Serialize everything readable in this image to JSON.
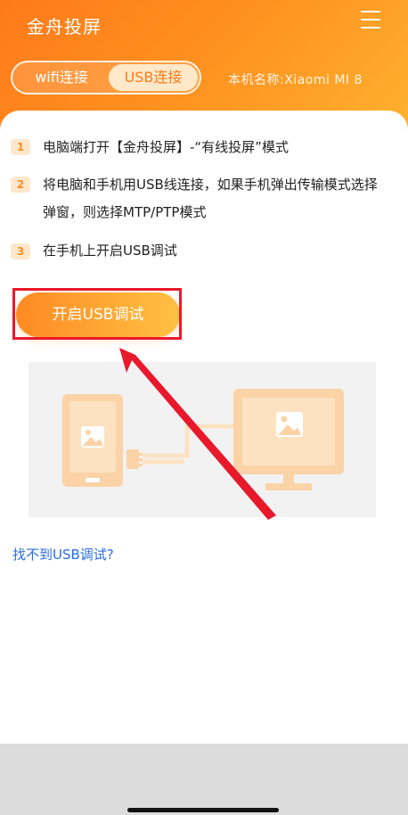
{
  "header": {
    "title": "金舟投屏",
    "device_name": "本机名称:Xiaomi  MI 8",
    "tabs": [
      {
        "label": "wifi连接",
        "selected": false
      },
      {
        "label": "USB连接",
        "selected": true
      }
    ]
  },
  "steps": [
    {
      "num": "1",
      "text": "电脑端打开【金舟投屏】-“有线投屏”模式"
    },
    {
      "num": "2",
      "text": "将电脑和手机用USB线连接，如果手机弹出传输模式选择弹窗，则选择MTP/PTP模式"
    },
    {
      "num": "3",
      "text": "在手机上开启USB调试"
    }
  ],
  "primary_button": {
    "label": "开启USB调试"
  },
  "help_link": {
    "label": "找不到USB调试?"
  },
  "colors": {
    "accent": "#ff8a22",
    "accent_light": "#ffc143",
    "highlight": "#e8192b",
    "link": "#2a6de0"
  },
  "icons": [
    "menu-icon",
    "phone-illustration",
    "usb-plug-icon",
    "monitor-illustration",
    "image-icon"
  ]
}
